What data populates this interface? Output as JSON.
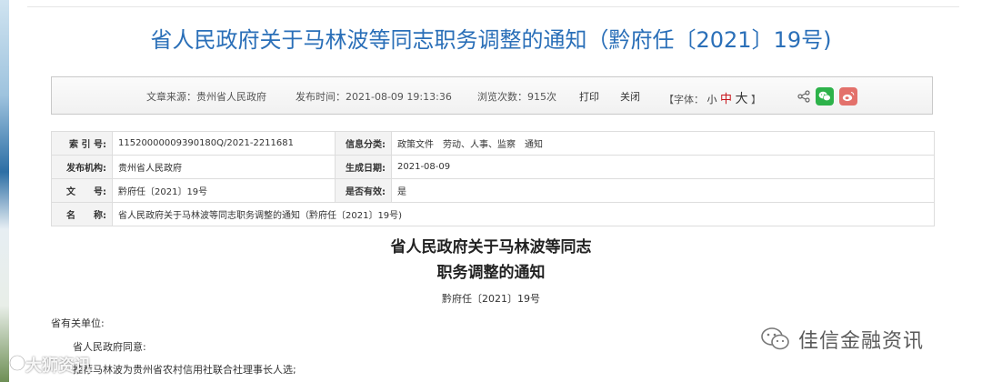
{
  "page": {
    "title": "省人民政府关于马林波等同志职务调整的通知（黔府任〔2021〕19号)"
  },
  "meta_bar": {
    "source": "文章来源：贵州省人民政府",
    "publish_time": "发布时间：2021-08-09 19:13:36",
    "views": "浏览次数：915次",
    "print": "打印",
    "close": "关闭",
    "font_prefix": "【字体：",
    "font_small": "小",
    "font_medium": "中",
    "font_large": "大",
    "font_suffix": "】"
  },
  "info_table": {
    "rows": [
      {
        "l1": "索 引 号:",
        "v1": "11520000009390180Q/2021-2211681",
        "l2": "信息分类:",
        "v2": "政策文件　劳动、人事、监察　通知"
      },
      {
        "l1": "发布机构:",
        "v1": "贵州省人民政府",
        "l2": "生成日期:",
        "v2": "2021-08-09"
      },
      {
        "l1": "文　　号:",
        "v1": "黔府任〔2021〕19号",
        "l2": "是否有效:",
        "v2": "是"
      }
    ],
    "name_label": "名　　称:",
    "name_value": "省人民政府关于马林波等同志职务调整的通知（黔府任〔2021〕19号)"
  },
  "document": {
    "title_line1": "省人民政府关于马林波等同志",
    "title_line2": "职务调整的通知",
    "number": "黔府任〔2021〕19号",
    "salutation": "省有关单位:",
    "line1": "省人民政府同意:",
    "line2": "推荐马林波为贵州省农村信用社联合社理事长人选;"
  },
  "watermarks": {
    "left": "大狮资讯",
    "right": "佳信金融资讯"
  },
  "icons": {
    "share": "share-icon",
    "wechat": "wechat-icon",
    "weibo": "weibo-icon"
  },
  "colors": {
    "title_blue": "#2a6fb8",
    "font_medium_red": "#c8161d",
    "wechat_green": "#2db24a",
    "weibo_red": "#e3716b"
  }
}
